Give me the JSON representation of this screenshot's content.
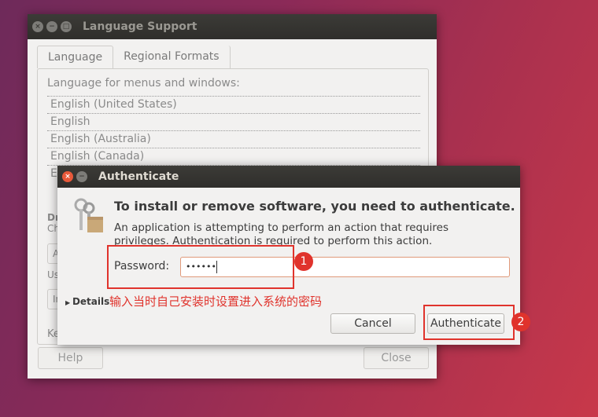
{
  "language_support": {
    "title": "Language Support",
    "tabs": [
      {
        "label": "Language"
      },
      {
        "label": "Regional Formats"
      }
    ],
    "section_label": "Language for menus and windows:",
    "languages": [
      "English (United States)",
      "English",
      "English (Australia)",
      "English (Canada)",
      "E"
    ],
    "partial_labels": [
      "Dr",
      "Ch",
      "A",
      "Us",
      "In",
      "Ke"
    ],
    "help_label": "Help",
    "close_label": "Close"
  },
  "auth": {
    "title": "Authenticate",
    "heading": "To install or remove software, you need to authenticate.",
    "description": "An application is attempting to perform an action that requires privileges. Authentication is required to perform this action.",
    "password_label": "Password:",
    "password_value": "••••••",
    "details_label": "Details",
    "cancel_label": "Cancel",
    "authenticate_label": "Authenticate"
  },
  "annotations": {
    "note": "输入当时自己安装时设置进入系统的密码",
    "badge1": "1",
    "badge2": "2",
    "color": "#e0332c"
  }
}
